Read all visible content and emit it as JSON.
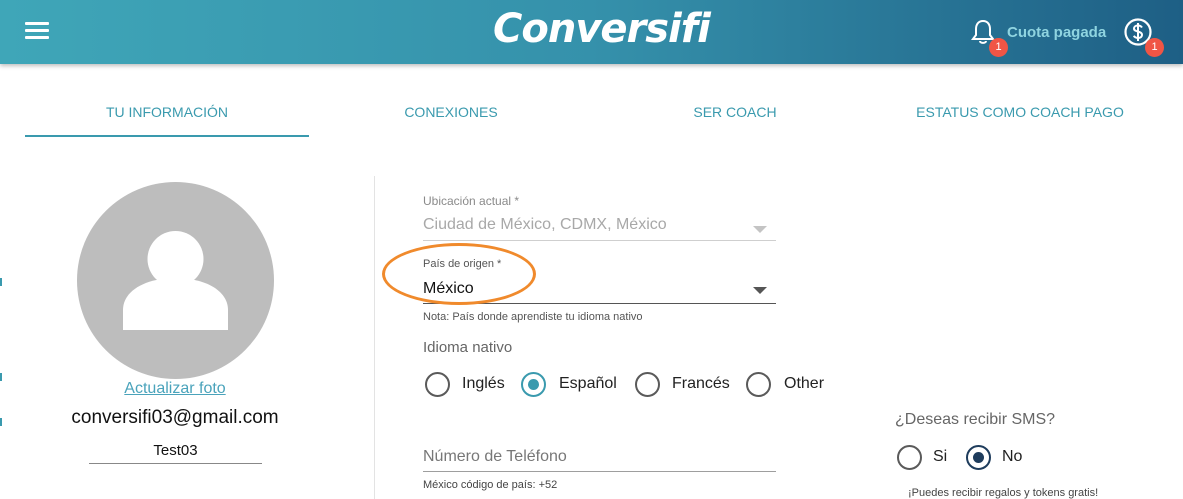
{
  "header": {
    "logo_text": "Conversifi",
    "notifications_count": "1",
    "status_text": "Cuota pagada",
    "payments_count": "1"
  },
  "tabs": [
    {
      "label": "TU INFORMACIÓN",
      "active": true
    },
    {
      "label": "CONEXIONES",
      "active": false
    },
    {
      "label": "SER COACH",
      "active": false
    },
    {
      "label": "ESTATUS COMO COACH PAGO",
      "active": false
    }
  ],
  "profile": {
    "update_photo_label": "Actualizar foto",
    "email": "conversifi03@gmail.com",
    "username": "Test03"
  },
  "form": {
    "location": {
      "label": "Ubicación actual *",
      "value": "Ciudad de México, CDMX, México"
    },
    "origin_country": {
      "label": "País de origen *",
      "value": "México",
      "note": "Nota: País donde aprendiste tu idioma nativo"
    },
    "native_language": {
      "label": "Idioma nativo",
      "options": [
        "Inglés",
        "Español",
        "Francés",
        "Other"
      ],
      "selected": "Español"
    },
    "phone": {
      "placeholder": "Número de Teléfono",
      "note": "México código de país: +52"
    },
    "sms": {
      "label": "¿Deseas recibir SMS?",
      "options": [
        "Si",
        "No"
      ],
      "selected": "No",
      "note": "¡Puedes recibir regalos y tokens gratis!"
    }
  },
  "colors": {
    "accent": "#3a9aae",
    "highlight": "#f08a2c",
    "badge": "#f05545"
  },
  "icons": {
    "menu": "hamburger-menu-icon",
    "notifications": "bell-icon",
    "payments": "dollar-circle-icon",
    "avatar": "person-icon"
  }
}
